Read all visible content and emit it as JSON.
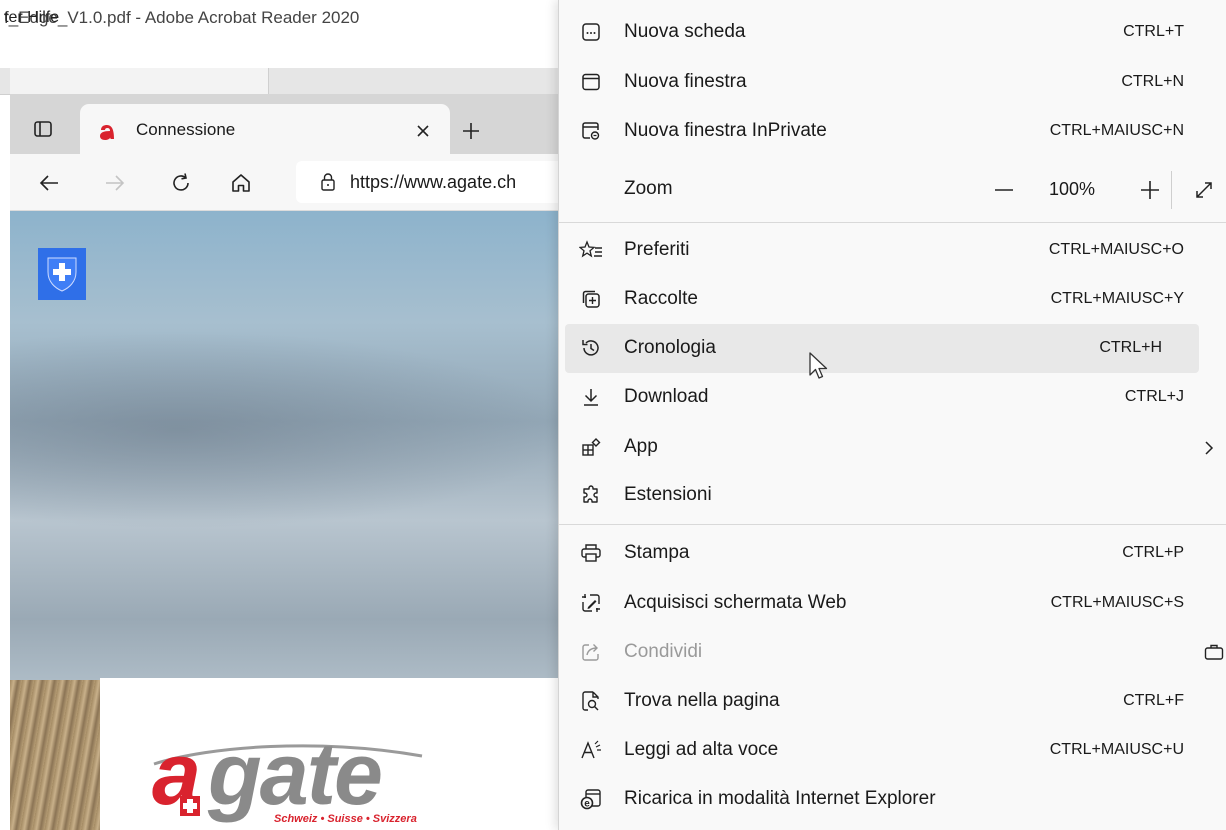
{
  "acrobat": {
    "title": "f_Edge_V1.0.pdf - Adobe Acrobat Reader 2020",
    "menu_label": "ter  Hilfe"
  },
  "edge": {
    "tab_title": "Connessione",
    "address": "https://www.agate.ch"
  },
  "site": {
    "logo_text": "agate",
    "logo_tagline": "Schweiz • Suisse • Svizzera"
  },
  "menu": {
    "new_tab": {
      "label": "Nuova scheda",
      "shortcut": "CTRL+T"
    },
    "new_window": {
      "label": "Nuova finestra",
      "shortcut": "CTRL+N"
    },
    "inprivate": {
      "label": "Nuova finestra InPrivate",
      "shortcut": "CTRL+MAIUSC+N"
    },
    "zoom": {
      "label": "Zoom",
      "value": "100%"
    },
    "favorites": {
      "label": "Preferiti",
      "shortcut": "CTRL+MAIUSC+O"
    },
    "collections": {
      "label": "Raccolte",
      "shortcut": "CTRL+MAIUSC+Y"
    },
    "history": {
      "label": "Cronologia",
      "shortcut": "CTRL+H"
    },
    "downloads": {
      "label": "Download",
      "shortcut": "CTRL+J"
    },
    "apps": {
      "label": "App"
    },
    "extensions": {
      "label": "Estensioni"
    },
    "print": {
      "label": "Stampa",
      "shortcut": "CTRL+P"
    },
    "web_capture": {
      "label": "Acquisisci schermata Web",
      "shortcut": "CTRL+MAIUSC+S"
    },
    "share": {
      "label": "Condividi"
    },
    "find": {
      "label": "Trova nella pagina",
      "shortcut": "CTRL+F"
    },
    "read_aloud": {
      "label": "Leggi ad alta voce",
      "shortcut": "CTRL+MAIUSC+U"
    },
    "ie_mode": {
      "label": "Ricarica in modalità Internet Explorer"
    }
  },
  "colors": {
    "annotation": "#e5161c",
    "agate_red": "#d9232e",
    "agate_grey": "#8a8a8a",
    "shield_blue": "#2f6fe8"
  }
}
